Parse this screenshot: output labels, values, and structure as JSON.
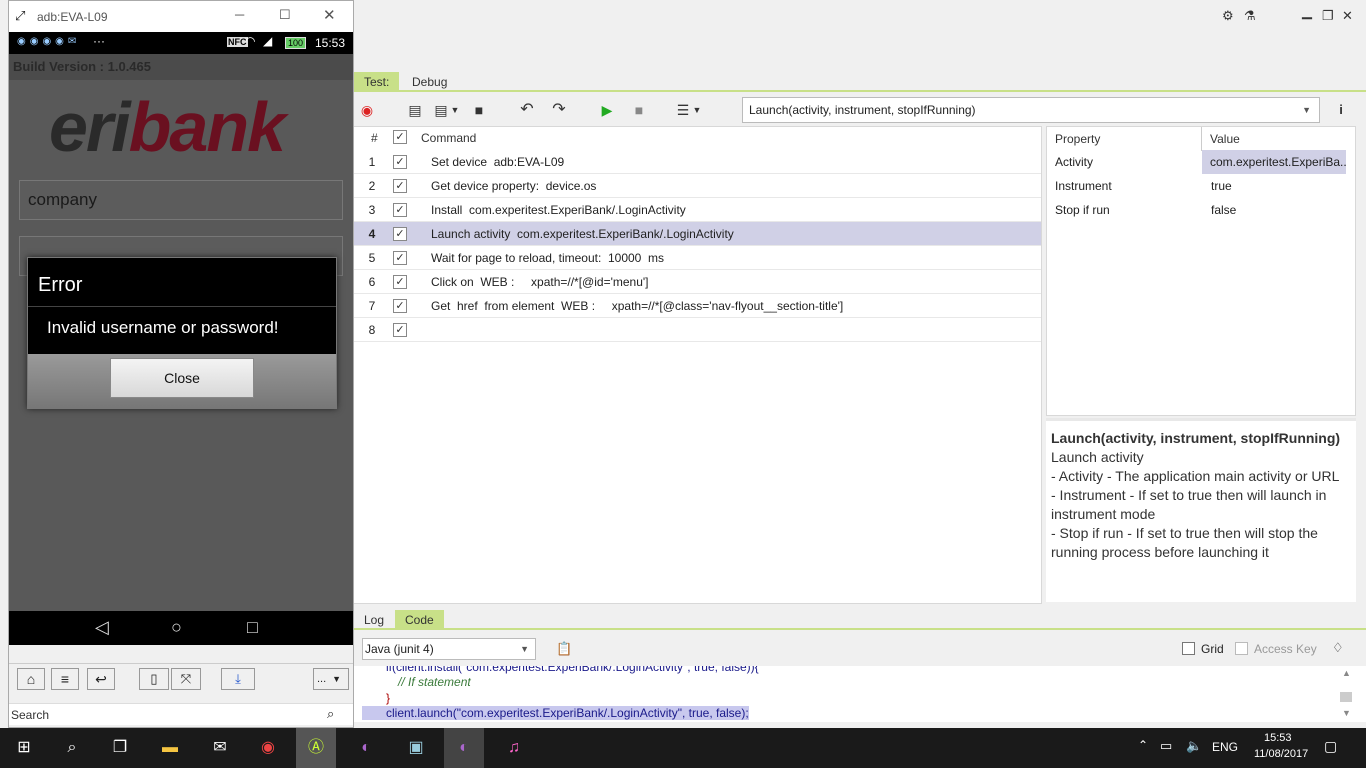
{
  "phone_window": {
    "title": "adb:EVA-L09",
    "status_time": "15:53",
    "status_nfc": "NFC",
    "status_battery": "100",
    "build_version": "Build Version : 1.0.465",
    "logo_text_1": "eri",
    "logo_text_2": "bank",
    "username_value": "company",
    "error_dialog": {
      "title": "Error",
      "message": "Invalid username or password!",
      "close_label": "Close"
    },
    "search_placeholder": "Search",
    "more_label": "..."
  },
  "tabs_top": {
    "test": "Test:",
    "debug": "Debug"
  },
  "command_select": {
    "value": "Launch(activity, instrument, stopIfRunning)"
  },
  "grid": {
    "headers": {
      "num": "#",
      "command": "Command"
    },
    "rows": [
      {
        "num": "1",
        "text": "Set device  adb:EVA-L09"
      },
      {
        "num": "2",
        "text": "Get device property:  device.os"
      },
      {
        "num": "3",
        "text": "Install  com.experitest.ExperiBank/.LoginActivity"
      },
      {
        "num": "4",
        "text": "Launch activity  com.experitest.ExperiBank/.LoginActivity"
      },
      {
        "num": "5",
        "text": "Wait for page to reload, timeout:  10000  ms"
      },
      {
        "num": "6",
        "text": "Click on  WEB :     xpath=//*[@id='menu']"
      },
      {
        "num": "7",
        "text": "Get  href  from element  WEB :     xpath=//*[@class='nav-flyout__section-title']"
      },
      {
        "num": "8",
        "text": ""
      }
    ]
  },
  "properties": {
    "headers": {
      "property": "Property",
      "value": "Value"
    },
    "rows": [
      {
        "key": "Activity",
        "value": "com.experitest.ExperiBa..."
      },
      {
        "key": "Instrument",
        "value": "true"
      },
      {
        "key": "Stop if run",
        "value": "false"
      }
    ]
  },
  "description": {
    "title": "Launch(activity, instrument, stopIfRunning)",
    "line1": "Launch activity",
    "line2": "- Activity - The application main activity or URL",
    "line3": "- Instrument - If set to true then will launch in instrument mode",
    "line4": "- Stop if run - If set to true then will stop the running process before launching it"
  },
  "tabs_bottom": {
    "log": "Log",
    "code": "Code"
  },
  "code_panel": {
    "language": "Java (junit 4)",
    "grid_label": "Grid",
    "access_key_label": "Access Key",
    "lines": [
      "if(client.install(\"com.experitest.ExperiBank/.LoginActivity\", true, false)){",
      "// If statement",
      "}",
      "client.launch(\"com.experitest.ExperiBank/.LoginActivity\", true, false);"
    ]
  },
  "taskbar": {
    "language": "ENG",
    "time": "15:53",
    "date": "11/08/2017"
  },
  "colors": {
    "tab_active": "#c8e088",
    "selected_row": "#d0d0e6",
    "logo_dark": "#2a2a2a",
    "logo_red": "#c0102a"
  }
}
